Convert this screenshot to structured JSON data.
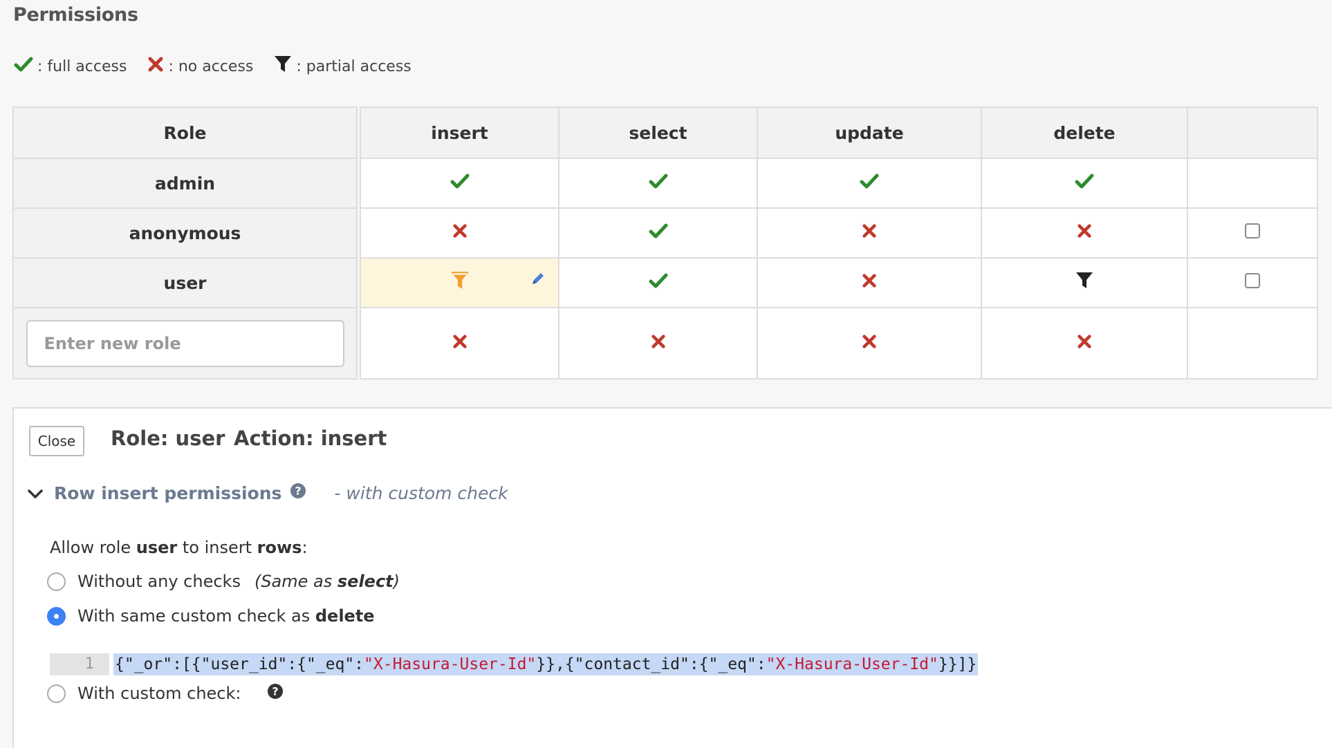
{
  "page": {
    "title": "Permissions"
  },
  "legend": [
    {
      "icon": "check-icon",
      "label": ": full access"
    },
    {
      "icon": "cross-icon",
      "label": ": no access"
    },
    {
      "icon": "filter-icon",
      "label": ": partial access"
    }
  ],
  "table": {
    "headers": {
      "role": "Role",
      "insert": "insert",
      "select": "select",
      "update": "update",
      "delete": "delete"
    },
    "rows": [
      {
        "role": "admin",
        "insert": "full",
        "select": "full",
        "update": "full",
        "delete": "full",
        "checkbox": false
      },
      {
        "role": "anonymous",
        "insert": "none",
        "select": "full",
        "update": "none",
        "delete": "none",
        "checkbox": true
      },
      {
        "role": "user",
        "insert": "partial-editing",
        "select": "full",
        "update": "none",
        "delete": "partial",
        "checkbox": true
      }
    ],
    "new_role": {
      "placeholder": "Enter new role",
      "insert": "none",
      "select": "none",
      "update": "none",
      "delete": "none"
    }
  },
  "panel": {
    "close_label": "Close",
    "role_title": "Role: user",
    "action_title": "Action: insert",
    "section_label": "Row insert permissions",
    "section_sub": "- with custom check",
    "allow": {
      "prefix": "Allow role ",
      "role": "user",
      "middle": " to insert ",
      "object": "rows",
      "suffix": ":"
    },
    "options": [
      {
        "label": "Without any checks",
        "note_prefix": "(Same as ",
        "note_bold": "select",
        "note_suffix": ")",
        "selected": false
      },
      {
        "label_prefix": "With same custom check as ",
        "label_bold": "delete",
        "selected": true
      },
      {
        "label": "With custom check:",
        "selected": false
      }
    ],
    "code": {
      "line_number": "1",
      "part1": "{\"_or\":[{\"user_id\":{\"_eq\":",
      "str1": "\"X-Hasura-User-Id\"",
      "part2": "}},{\"contact_id\":{\"_eq\":",
      "str2": "\"X-Hasura-User-Id\"",
      "part3": "}}]}"
    }
  },
  "colors": {
    "full": "#2e8b2e",
    "none": "#c0392b",
    "partial": "#222222",
    "editing_partial": "#f0a030",
    "accent": "#3b82f6"
  }
}
